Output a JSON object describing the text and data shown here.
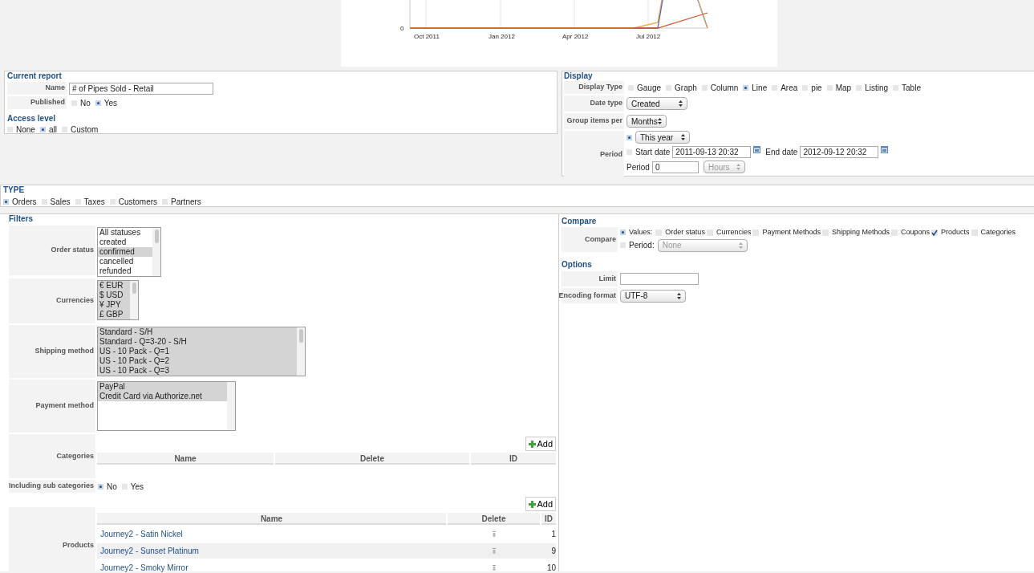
{
  "chart": {
    "y_tick": "0",
    "x_labels": [
      "Oct 2011",
      "Jan 2012",
      "Apr 2012",
      "Jul 2012"
    ]
  },
  "current_report": {
    "title": "Current report",
    "name": {
      "label": "Name",
      "value": "# of Pipes Sold - Retail"
    },
    "published": {
      "label": "Published",
      "options": [
        {
          "label": "No",
          "selected": false
        },
        {
          "label": "Yes",
          "selected": true
        }
      ]
    },
    "access_level": {
      "title": "Access level",
      "options": [
        {
          "label": "None",
          "selected": false
        },
        {
          "label": "all",
          "selected": true
        },
        {
          "label": "Custom",
          "selected": false
        }
      ]
    }
  },
  "display": {
    "title": "Display",
    "display_type": {
      "label": "Display Type",
      "options": [
        {
          "label": "Gauge",
          "selected": false
        },
        {
          "label": "Graph",
          "selected": false
        },
        {
          "label": "Column",
          "selected": false
        },
        {
          "label": "Line",
          "selected": true
        },
        {
          "label": "Area",
          "selected": false
        },
        {
          "label": "pie",
          "selected": false
        },
        {
          "label": "Map",
          "selected": false
        },
        {
          "label": "Listing",
          "selected": false
        },
        {
          "label": "Table",
          "selected": false
        }
      ]
    },
    "date_type": {
      "label": "Date type",
      "value": "Created"
    },
    "group_items_per": {
      "label": "Group items per",
      "value": "Months"
    },
    "period": {
      "label": "Period",
      "preset": {
        "value": "This year",
        "selected": true
      },
      "range": {
        "selected": false,
        "start_label": "Start date",
        "start_value": "2011-09-13 20:32",
        "end_label": "End date",
        "end_value": "2012-09-12 20:32"
      },
      "length_label": "Period",
      "length_value": "0",
      "unit": {
        "value": "Hours",
        "disabled": true
      }
    }
  },
  "type": {
    "title": "TYPE",
    "options": [
      {
        "label": "Orders",
        "selected": true
      },
      {
        "label": "Sales",
        "selected": false
      },
      {
        "label": "Taxes",
        "selected": false
      },
      {
        "label": "Customers",
        "selected": false
      },
      {
        "label": "Partners",
        "selected": false
      }
    ]
  },
  "filters": {
    "title": "Filters",
    "rows": [
      {
        "kind": "listbox",
        "label": "Order status",
        "items": [
          {
            "text": "All statuses",
            "selected": false
          },
          {
            "text": "created",
            "selected": false
          },
          {
            "text": "confirmed",
            "selected": true
          },
          {
            "text": "cancelled",
            "selected": false
          },
          {
            "text": "refunded",
            "selected": false
          }
        ]
      },
      {
        "kind": "listbox",
        "label": "Currencies",
        "items": [
          {
            "text": "€ EUR",
            "selected": true
          },
          {
            "text": "$ USD",
            "selected": true
          },
          {
            "text": "¥ JPY",
            "selected": true
          },
          {
            "text": "£ GBP",
            "selected": true
          }
        ]
      },
      {
        "kind": "listbox",
        "label": "Shipping method",
        "items": [
          {
            "text": "Standard - S/H",
            "selected": true
          },
          {
            "text": "Standard - Q=3-20 - S/H",
            "selected": true
          },
          {
            "text": "US - 10 Pack - Q=1",
            "selected": true
          },
          {
            "text": "US - 10 Pack - Q=2",
            "selected": true
          },
          {
            "text": "US - 10 Pack - Q=3",
            "selected": true
          }
        ]
      },
      {
        "kind": "listbox",
        "label": "Payment method",
        "items": [
          {
            "text": "PayPal",
            "selected": true
          },
          {
            "text": "Credit Card via Authorize.net",
            "selected": true
          }
        ]
      },
      {
        "kind": "table",
        "label": "Categories",
        "button": "Add",
        "columns": [
          "Name",
          "Delete",
          "ID"
        ],
        "rows": []
      },
      {
        "kind": "radios",
        "label": "Including sub categories",
        "options": [
          {
            "label": "No",
            "selected": true
          },
          {
            "label": "Yes",
            "selected": false
          }
        ]
      },
      {
        "kind": "table",
        "label": "Products",
        "button": "Add",
        "columns": [
          "Name",
          "Delete",
          "ID"
        ],
        "rows": [
          {
            "name": "Journey2 - Satin Nickel",
            "id": "1"
          },
          {
            "name": "Journey2 - Sunset Platinum",
            "id": "9"
          },
          {
            "name": "Journey2 - Smoky Mirror",
            "id": "10"
          }
        ]
      }
    ]
  },
  "compare": {
    "title": "Compare",
    "label": "Compare",
    "values": {
      "label": "Values:",
      "selected": true
    },
    "checks": [
      {
        "label": "Order status",
        "checked": false
      },
      {
        "label": "Currencies",
        "checked": false
      },
      {
        "label": "Payment Methods",
        "checked": false
      },
      {
        "label": "Shipping Methods",
        "checked": false
      },
      {
        "label": "Coupons",
        "checked": false
      },
      {
        "label": "Products",
        "checked": true
      },
      {
        "label": "Categories",
        "checked": false
      }
    ],
    "period": {
      "label": "Period:",
      "selected": false
    },
    "period_select": {
      "value": "None",
      "disabled": true
    }
  },
  "options": {
    "title": "Options",
    "limit": {
      "label": "Limit"
    },
    "encoding": {
      "label": "Encoding format",
      "value": "UTF-8"
    }
  }
}
